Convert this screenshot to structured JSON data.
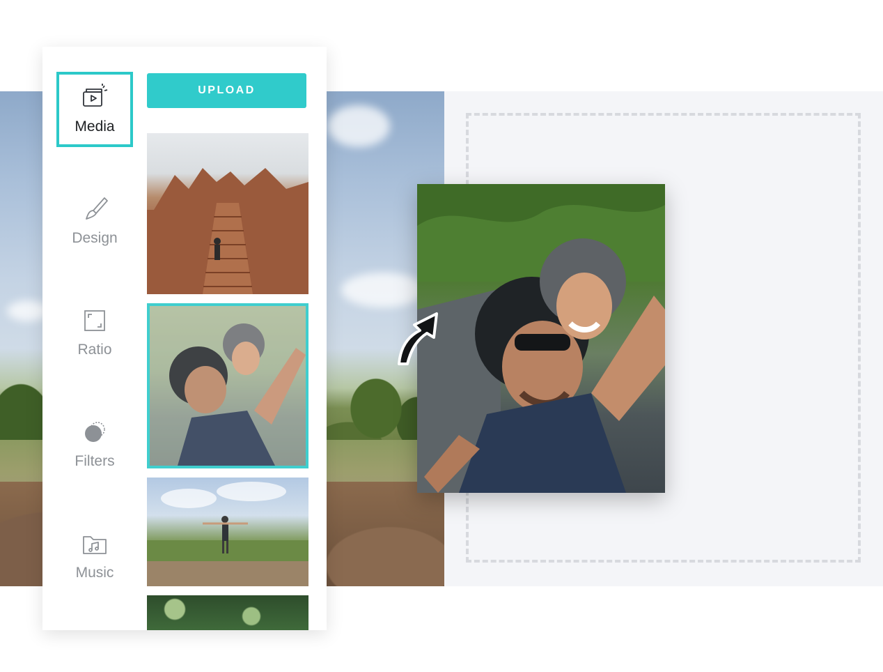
{
  "sidebar": {
    "items": [
      {
        "label": "Media",
        "icon": "media-icon",
        "active": true
      },
      {
        "label": "Design",
        "icon": "brush-icon",
        "active": false
      },
      {
        "label": "Ratio",
        "icon": "ratio-icon",
        "active": false
      },
      {
        "label": "Filters",
        "icon": "filters-icon",
        "active": false
      },
      {
        "label": "Music",
        "icon": "music-icon",
        "active": false
      }
    ]
  },
  "media": {
    "upload_label": "UPLOAD"
  },
  "colors": {
    "accent": "#30cbcb",
    "nav_text": "#8d9196",
    "active_text": "#1d1f22",
    "dropzone_border": "#d7d9de"
  }
}
